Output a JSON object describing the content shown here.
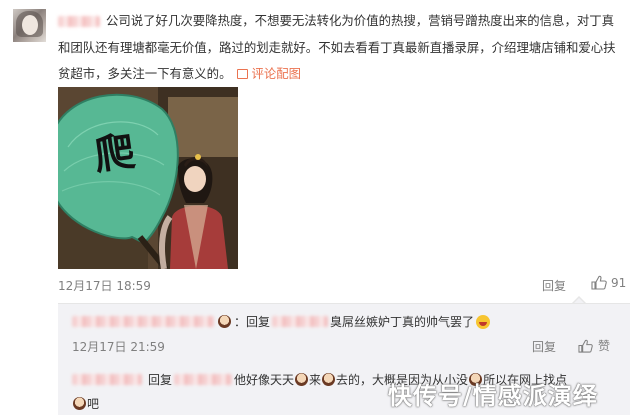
{
  "comment": {
    "text": "公司说了好几次要降热度，不想要无法转化为价值的热搜，营销号蹭热度出来的信息，对丁真和团队还有理塘都毫无价值，路过的划走就好。不如去看看丁真最新直播录屏，介绍理塘店铺和爱心扶贫超市，多关注一下有意义的。",
    "pic_link_label": "评论配图",
    "meme_char": "爬",
    "timestamp": "12月17日 18:59",
    "reply_label": "回复",
    "like_count": "91"
  },
  "replies": [
    {
      "reply_prefix": "回复",
      "text": "臭屌丝嫉妒丁真的帅气罢了",
      "timestamp": "12月17日 21:59",
      "reply_label": "回复",
      "like_label": "赞"
    },
    {
      "reply_prefix": "回复",
      "text_a": "他好像天天",
      "text_b": "来",
      "text_c": "去的，大概是因为从小没",
      "text_d": "所以在网上找点",
      "text_e": "吧"
    }
  ],
  "watermark": "快传号/情感派演绎",
  "colors": {
    "link": "#eb7350",
    "meta": "#808080",
    "sub_bg": "#f2f2f5"
  },
  "icons": [
    "pic-icon",
    "thumb-up-icon",
    "emoji-face-icon",
    "emoji-laugh-icon"
  ]
}
